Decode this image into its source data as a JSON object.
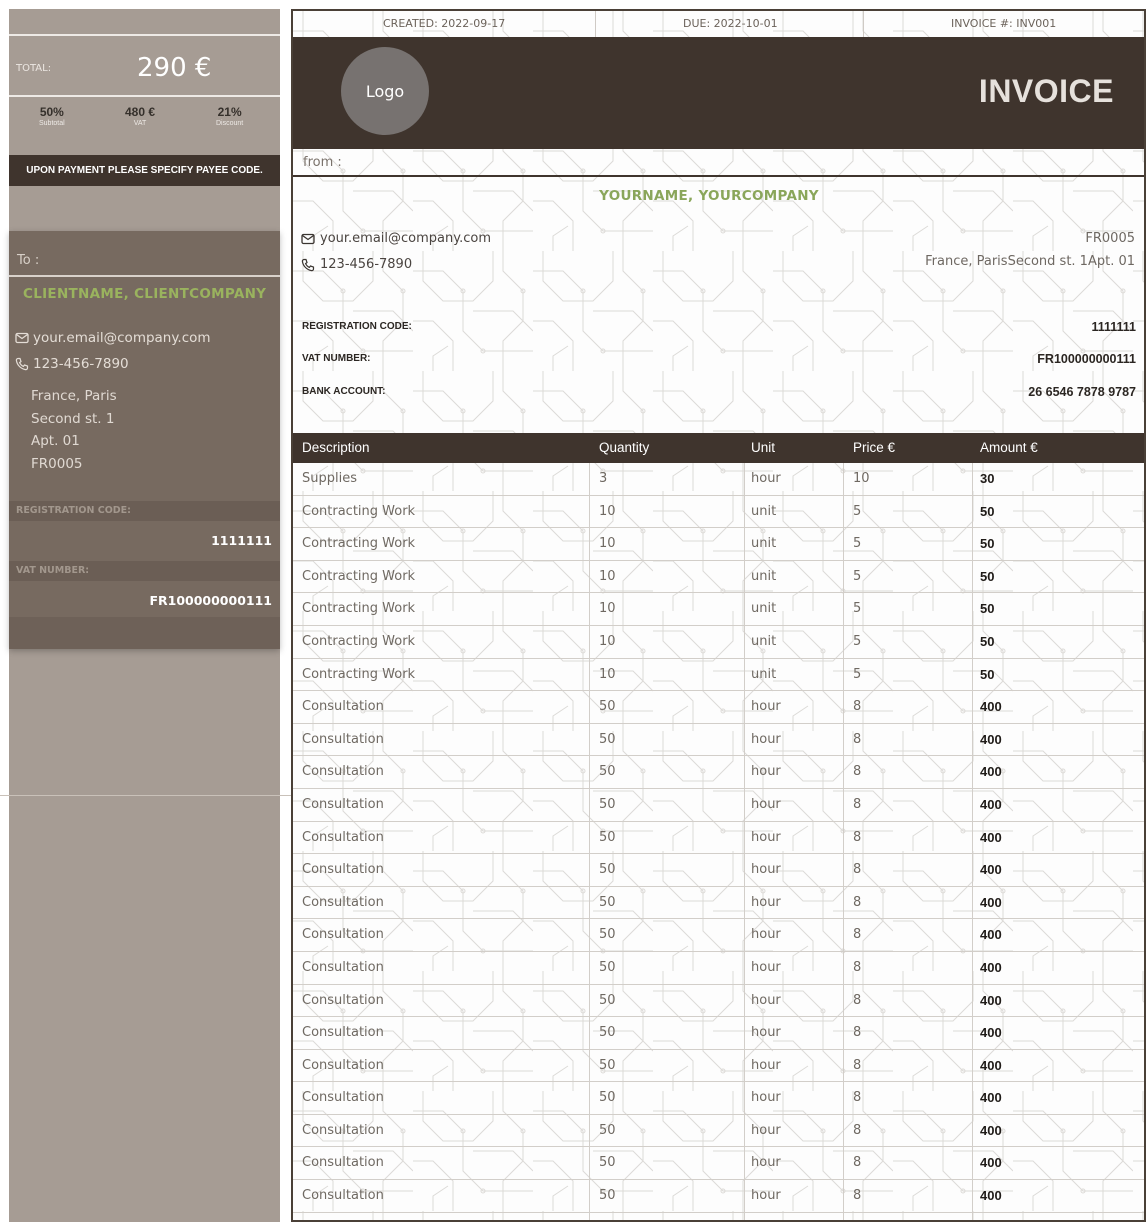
{
  "summary": {
    "total_label": "TOTAL:",
    "total_value": "290 €",
    "stats": [
      {
        "value": "50%",
        "label": "Subtotal"
      },
      {
        "value": "480 €",
        "label": "VAT"
      },
      {
        "value": "21%",
        "label": "Discount"
      }
    ],
    "payee_note": "UPON PAYMENT PLEASE SPECIFY PAYEE CODE."
  },
  "client": {
    "to_label": "To :",
    "name": "CLIENTNAME, CLIENTCOMPANY",
    "email": "your.email@company.com",
    "phone": "123-456-7890",
    "address": [
      "France, Paris",
      "Second st. 1",
      "Apt. 01",
      "FR0005"
    ],
    "registration_label": "REGISTRATION CODE:",
    "registration_value": "1111111",
    "vat_label": "VAT NUMBER:",
    "vat_value": "FR100000000111"
  },
  "header": {
    "created": "CREATED: 2022-09-17",
    "due": "DUE: 2022-10-01",
    "invoice_no": "INVOICE #: INV001",
    "logo_text": "Logo",
    "title": "INVOICE"
  },
  "sender": {
    "from_label": "from :",
    "name": "YOURNAME, YOURCOMPANY",
    "email": "your.email@company.com",
    "phone": "123-456-7890",
    "code": "FR0005",
    "address": "France, ParisSecond st. 1Apt. 01",
    "registration_label": "REGISTRATION CODE:",
    "registration_value": "1111111",
    "vat_label": "VAT NUMBER:",
    "vat_value": "FR100000000111",
    "bank_label": "BANK ACCOUNT:",
    "bank_value": "26 6546 7878 9787"
  },
  "items": {
    "columns": [
      "Description",
      "Quantity",
      "Unit",
      "Price €",
      "Amount €"
    ],
    "rows": [
      [
        "Supplies",
        "3",
        "hour",
        "10",
        "30"
      ],
      [
        "Contracting Work",
        "10",
        "unit",
        "5",
        "50"
      ],
      [
        "Contracting Work",
        "10",
        "unit",
        "5",
        "50"
      ],
      [
        "Contracting Work",
        "10",
        "unit",
        "5",
        "50"
      ],
      [
        "Contracting Work",
        "10",
        "unit",
        "5",
        "50"
      ],
      [
        "Contracting Work",
        "10",
        "unit",
        "5",
        "50"
      ],
      [
        "Contracting Work",
        "10",
        "unit",
        "5",
        "50"
      ],
      [
        "Consultation",
        "50",
        "hour",
        "8",
        "400"
      ],
      [
        "Consultation",
        "50",
        "hour",
        "8",
        "400"
      ],
      [
        "Consultation",
        "50",
        "hour",
        "8",
        "400"
      ],
      [
        "Consultation",
        "50",
        "hour",
        "8",
        "400"
      ],
      [
        "Consultation",
        "50",
        "hour",
        "8",
        "400"
      ],
      [
        "Consultation",
        "50",
        "hour",
        "8",
        "400"
      ],
      [
        "Consultation",
        "50",
        "hour",
        "8",
        "400"
      ],
      [
        "Consultation",
        "50",
        "hour",
        "8",
        "400"
      ],
      [
        "Consultation",
        "50",
        "hour",
        "8",
        "400"
      ],
      [
        "Consultation",
        "50",
        "hour",
        "8",
        "400"
      ],
      [
        "Consultation",
        "50",
        "hour",
        "8",
        "400"
      ],
      [
        "Consultation",
        "50",
        "hour",
        "8",
        "400"
      ],
      [
        "Consultation",
        "50",
        "hour",
        "8",
        "400"
      ],
      [
        "Consultation",
        "50",
        "hour",
        "8",
        "400"
      ],
      [
        "Consultation",
        "50",
        "hour",
        "8",
        "400"
      ],
      [
        "Consultation",
        "50",
        "hour",
        "8",
        "400"
      ]
    ]
  },
  "colors": {
    "sidebar_bg": "#a69c94",
    "client_card_bg": "#776a60",
    "dark_brown": "#3f342d",
    "accent_green": "#8aa65a"
  }
}
